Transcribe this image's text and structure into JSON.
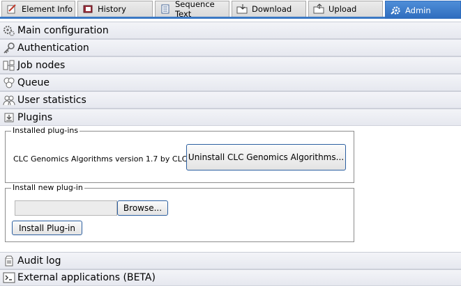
{
  "tabs": [
    {
      "label": "Element Info",
      "icon": "element-info-icon"
    },
    {
      "label": "History",
      "icon": "history-icon"
    },
    {
      "label": "Sequence Text",
      "icon": "document-icon"
    },
    {
      "label": "Download",
      "icon": "folder-download-icon"
    },
    {
      "label": "Upload",
      "icon": "folder-upload-icon"
    },
    {
      "label": "Admin",
      "icon": "admin-gear-icon",
      "active": true
    }
  ],
  "sections": {
    "main_configuration": "Main configuration",
    "authentication": "Authentication",
    "job_nodes": "Job nodes",
    "queue": "Queue",
    "user_statistics": "User statistics",
    "plugins": "Plugins",
    "audit_log": "Audit log",
    "external_applications": "External applications (BETA)"
  },
  "plugins": {
    "installed_legend": "Installed plug-ins",
    "installed_text": "CLC Genomics Algorithms version 1.7 by CLC bio",
    "uninstall_label": "Uninstall CLC Genomics Algorithms...",
    "install_legend": "Install new plug-in",
    "file_value": "",
    "browse_label": "Browse...",
    "install_label": "Install Plug-in"
  },
  "colors": {
    "accent": "#3a78c4",
    "active_tab": "#2e6cbd",
    "section_bg": "#e9ebf1"
  }
}
